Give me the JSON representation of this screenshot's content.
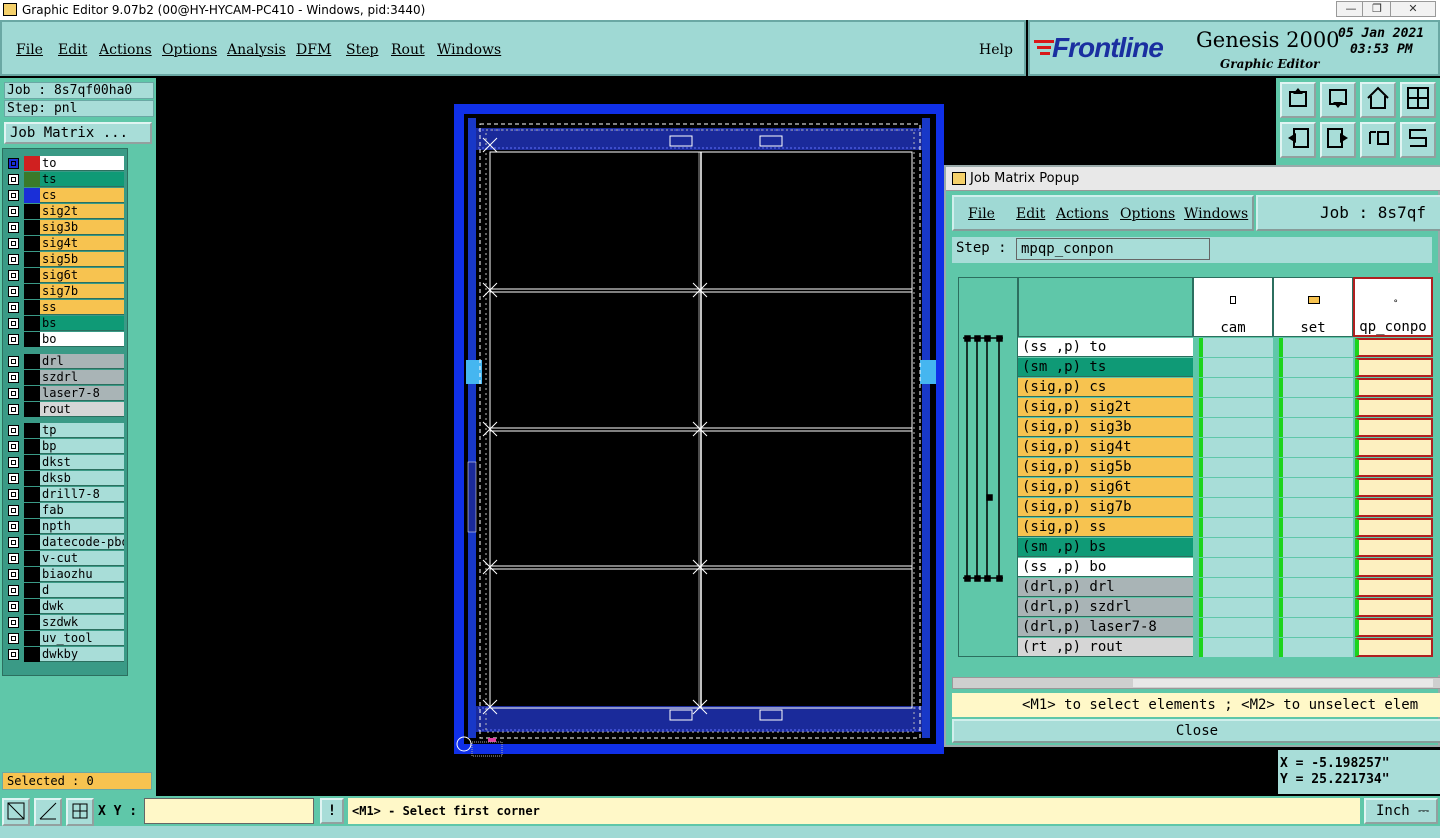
{
  "window": {
    "title": "Graphic Editor 9.07b2 (00@HY-HYCAM-PC410 - Windows, pid:3440)",
    "controls": [
      "—",
      "❐",
      "✕"
    ]
  },
  "menu": [
    "File",
    "Edit",
    "Actions",
    "Options",
    "Analysis",
    "DFM",
    "Step",
    "Rout",
    "Windows"
  ],
  "help_label": "Help",
  "brand": {
    "logo": "Frontline",
    "product": "Genesis 2000",
    "subtitle": "Graphic Editor",
    "date": "05 Jan 2021",
    "time": "03:53 PM"
  },
  "left_panel": {
    "job": "Job : 8s7qf00ha0",
    "step": "Step: pnl",
    "job_matrix_button": "Job Matrix ...",
    "selected": "Selected : 0",
    "groups": [
      [
        {
          "name": "to",
          "bg": "#ffffff",
          "swatch": "#d02020",
          "cb_bg": "#1a2fd8"
        },
        {
          "name": "ts",
          "bg": "#0f9a76",
          "swatch": "#3a7a2a"
        },
        {
          "name": "cs",
          "bg": "#f7c350",
          "swatch": "#1a2fd8"
        },
        {
          "name": "sig2t",
          "bg": "#f7c350",
          "swatch": "#000000"
        },
        {
          "name": "sig3b",
          "bg": "#f7c350",
          "swatch": "#000000"
        },
        {
          "name": "sig4t",
          "bg": "#f7c350",
          "swatch": "#000000"
        },
        {
          "name": "sig5b",
          "bg": "#f7c350",
          "swatch": "#000000"
        },
        {
          "name": "sig6t",
          "bg": "#f7c350",
          "swatch": "#000000"
        },
        {
          "name": "sig7b",
          "bg": "#f7c350",
          "swatch": "#000000"
        },
        {
          "name": "ss",
          "bg": "#f7c350",
          "swatch": "#000000"
        },
        {
          "name": "bs",
          "bg": "#0f9a76",
          "swatch": "#000000"
        },
        {
          "name": "bo",
          "bg": "#ffffff",
          "swatch": "#000000"
        }
      ],
      [
        {
          "name": "drl",
          "bg": "#a9b4b6",
          "swatch": "#000000"
        },
        {
          "name": "szdrl",
          "bg": "#a9b4b6",
          "swatch": "#000000"
        },
        {
          "name": "laser7-8",
          "bg": "#a9b4b6",
          "swatch": "#000000"
        },
        {
          "name": "rout",
          "bg": "#d6d6d6",
          "swatch": "#000000"
        }
      ],
      [
        {
          "name": "tp",
          "bg": "#a8ddd8",
          "swatch": "#000000"
        },
        {
          "name": "bp",
          "bg": "#a8ddd8",
          "swatch": "#000000"
        },
        {
          "name": "dkst",
          "bg": "#a8ddd8",
          "swatch": "#000000"
        },
        {
          "name": "dksb",
          "bg": "#a8ddd8",
          "swatch": "#000000"
        },
        {
          "name": "drill7-8",
          "bg": "#a8ddd8",
          "swatch": "#000000"
        },
        {
          "name": "fab",
          "bg": "#a8ddd8",
          "swatch": "#000000"
        },
        {
          "name": "npth",
          "bg": "#a8ddd8",
          "swatch": "#000000"
        },
        {
          "name": "datecode-pbo",
          "bg": "#a8ddd8",
          "swatch": "#000000"
        },
        {
          "name": "v-cut",
          "bg": "#a8ddd8",
          "swatch": "#000000"
        },
        {
          "name": "biaozhu",
          "bg": "#a8ddd8",
          "swatch": "#000000"
        },
        {
          "name": "d",
          "bg": "#a8ddd8",
          "swatch": "#000000"
        },
        {
          "name": "dwk",
          "bg": "#a8ddd8",
          "swatch": "#000000"
        },
        {
          "name": "szdwk",
          "bg": "#a8ddd8",
          "swatch": "#000000"
        },
        {
          "name": "uv_tool",
          "bg": "#a8ddd8",
          "swatch": "#000000"
        },
        {
          "name": "dwkby",
          "bg": "#a8ddd8",
          "swatch": "#000000"
        }
      ]
    ]
  },
  "popup": {
    "title": "Job Matrix Popup",
    "menu": [
      "File",
      "Edit",
      "Actions",
      "Options",
      "Windows"
    ],
    "job_label": "Job : 8s7qf",
    "step_label": "Step :",
    "step_value": "mpqp_conpon",
    "columns": [
      "cam",
      "set",
      "qp_conpo"
    ],
    "rows": [
      {
        "text": "(ss ,p) to",
        "bg": "#ffffff"
      },
      {
        "text": "(sm ,p) ts",
        "bg": "#0f9a76"
      },
      {
        "text": "(sig,p) cs",
        "bg": "#f7c350"
      },
      {
        "text": "(sig,p) sig2t",
        "bg": "#f7c350"
      },
      {
        "text": "(sig,p) sig3b",
        "bg": "#f7c350"
      },
      {
        "text": "(sig,p) sig4t",
        "bg": "#f7c350"
      },
      {
        "text": "(sig,p) sig5b",
        "bg": "#f7c350"
      },
      {
        "text": "(sig,p) sig6t",
        "bg": "#f7c350"
      },
      {
        "text": "(sig,p) sig7b",
        "bg": "#f7c350"
      },
      {
        "text": "(sig,p) ss",
        "bg": "#f7c350"
      },
      {
        "text": "(sm ,p) bs",
        "bg": "#0f9a76"
      },
      {
        "text": "(ss ,p) bo",
        "bg": "#ffffff"
      },
      {
        "text": "(drl,p) drl",
        "bg": "#a9b4b6"
      },
      {
        "text": "(drl,p) szdrl",
        "bg": "#a9b4b6"
      },
      {
        "text": "(drl,p) laser7-8",
        "bg": "#a9b4b6"
      },
      {
        "text": "(rt ,p) rout",
        "bg": "#d6d6d6"
      }
    ],
    "hint": "<M1> to select elements ; <M2> to unselect elem",
    "close_label": "Close"
  },
  "coords": {
    "x": "X = -5.198257\"",
    "y": "Y = 25.221734\""
  },
  "bottom": {
    "xy_label": "X Y :",
    "xy_value": "",
    "warn_icon": "!",
    "prompt": "<M1> - Select first corner",
    "units": "Inch",
    "units_icon": "⎓"
  },
  "toolbar_icons": [
    "upload-icon",
    "download-icon",
    "home-icon",
    "window-icon",
    "import-icon",
    "export-icon",
    "rotate-icon",
    "s-icon"
  ]
}
